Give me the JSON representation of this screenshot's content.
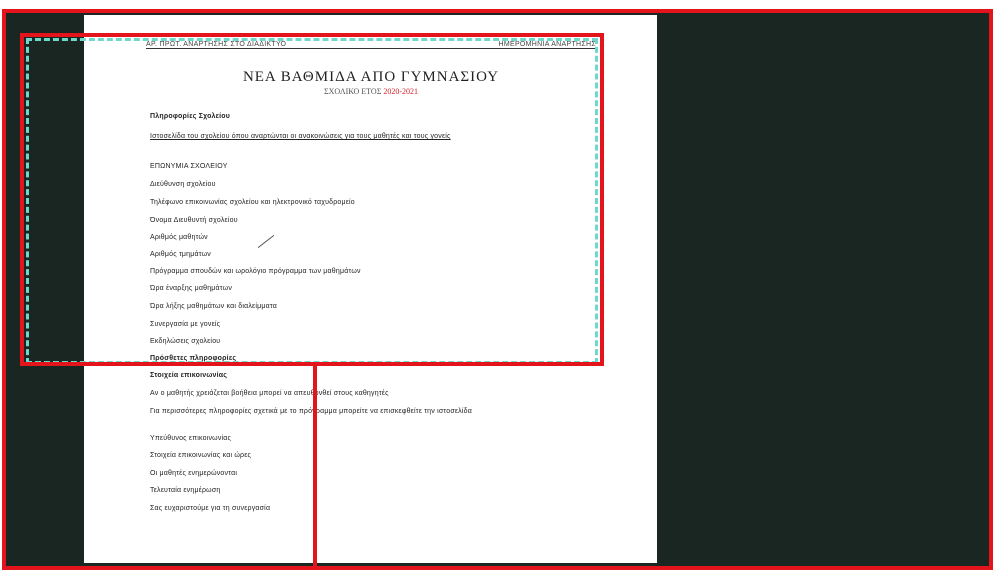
{
  "document": {
    "header_left": "ΑΡ. ΠΡΩΤ. ΑΝΑΡΤΗΣΗΣ ΣΤΟ ΔΙΑΔΙΚΤΥΟ",
    "header_right": "ΗΜΕΡΟΜΗΝΙΑ ΑΝΑΡΤΗΣΗΣ",
    "title": "ΝΕΑ ΒΑΘΜΙΔΑ ΑΠΟ ΓΥΜΝΑΣΙΟΥ",
    "subtitle_prefix": "ΣΧΟΛΙΚΟ ΕΤΟΣ",
    "subtitle_highlight": "2020-2021",
    "lines": [
      "Πληροφορίες Σχολείου",
      "Ιστοσελίδα του σχολείου όπου αναρτώνται οι ανακοινώσεις για τους μαθητές και τους γονείς",
      "ΕΠΩΝΥΜΙΑ ΣΧΟΛΕΙΟΥ",
      "Διεύθυνση σχολείου",
      "Τηλέφωνο επικοινωνίας σχολείου και ηλεκτρονικό ταχυδρομείο",
      "Όνομα Διευθυντή σχολείου",
      "Αριθμός μαθητών",
      "Αριθμός τμημάτων",
      "Πρόγραμμα σπουδών και ωρολόγιο πρόγραμμα των μαθημάτων",
      "Ώρα έναρξης μαθημάτων",
      "Ώρα λήξης μαθημάτων και διαλείμματα",
      "Συνεργασία με γονείς",
      "Εκδηλώσεις σχολείου",
      "Πρόσθετες πληροφορίες",
      "Στοιχεία επικοινωνίας",
      "Αν ο μαθητής χρειάζεται βοήθεια μπορεί να απευθυνθεί στους καθηγητές",
      "Για περισσότερες πληροφορίες σχετικά με το πρόγραμμα μπορείτε να επισκεφθείτε την ιστοσελίδα",
      "Υπεύθυνος επικοινωνίας",
      "Στοιχεία επικοινωνίας και ώρες",
      "Οι μαθητές ενημερώνονται",
      "Τελευταία ενημέρωση",
      "Σας ευχαριστούμε για τη συνεργασία"
    ]
  }
}
